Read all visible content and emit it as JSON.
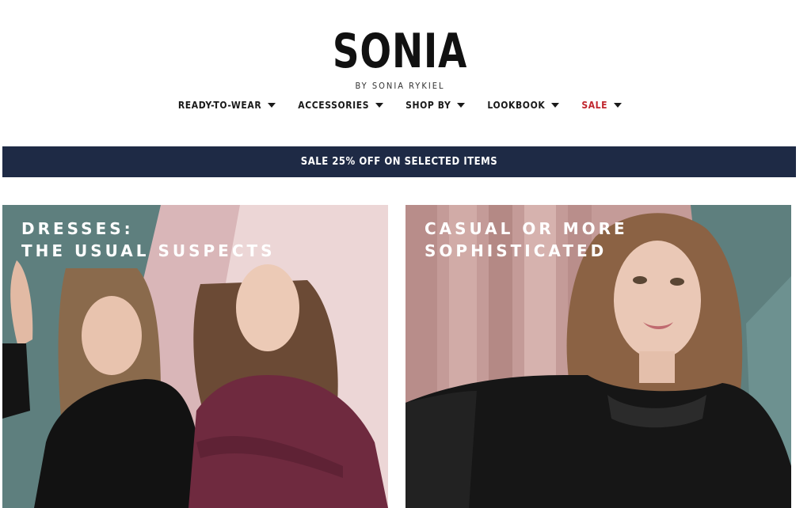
{
  "brand": {
    "logo": "SONIA",
    "tagline": "BY SONIA RYKIEL"
  },
  "nav": {
    "items": [
      {
        "label": "READY-TO-WEAR"
      },
      {
        "label": "ACCESSORIES"
      },
      {
        "label": "SHOP BY"
      },
      {
        "label": "LOOKBOOK"
      },
      {
        "label": "SALE"
      }
    ]
  },
  "promo": {
    "text": "SALE 25% OFF ON SELECTED ITEMS"
  },
  "panels": [
    {
      "title_line1": "DRESSES:",
      "title_line2": "THE USUAL SUSPECTS"
    },
    {
      "title_line1": "CASUAL OR MORE",
      "title_line2": "SOPHISTICATED"
    }
  ],
  "colors": {
    "promo_bg": "#1e2a45",
    "sale_accent": "#c0262e",
    "left_panel_bg": "#e6c8c9",
    "right_panel_bg": "#c9a6a3",
    "teal_backdrop": "#5e7f7e"
  }
}
